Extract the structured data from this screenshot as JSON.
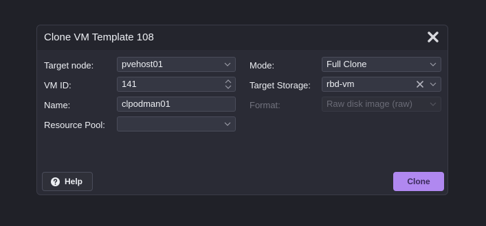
{
  "dialog": {
    "title": "Clone VM Template 108",
    "close_icon": "close-icon"
  },
  "form": {
    "target_node": {
      "label": "Target node:",
      "value": "pvehost01"
    },
    "vm_id": {
      "label": "VM ID:",
      "value": "141"
    },
    "name": {
      "label": "Name:",
      "value": "clpodman01"
    },
    "resource_pool": {
      "label": "Resource Pool:",
      "value": ""
    },
    "mode": {
      "label": "Mode:",
      "value": "Full Clone"
    },
    "target_storage": {
      "label": "Target Storage:",
      "value": "rbd-vm"
    },
    "format": {
      "label": "Format:",
      "value": "Raw disk image (raw)",
      "disabled": true
    }
  },
  "buttons": {
    "help_label": "Help",
    "clone_label": "Clone"
  },
  "colors": {
    "accent": "#b088f0",
    "background": "#202128",
    "dialog": "#2a2b35"
  }
}
